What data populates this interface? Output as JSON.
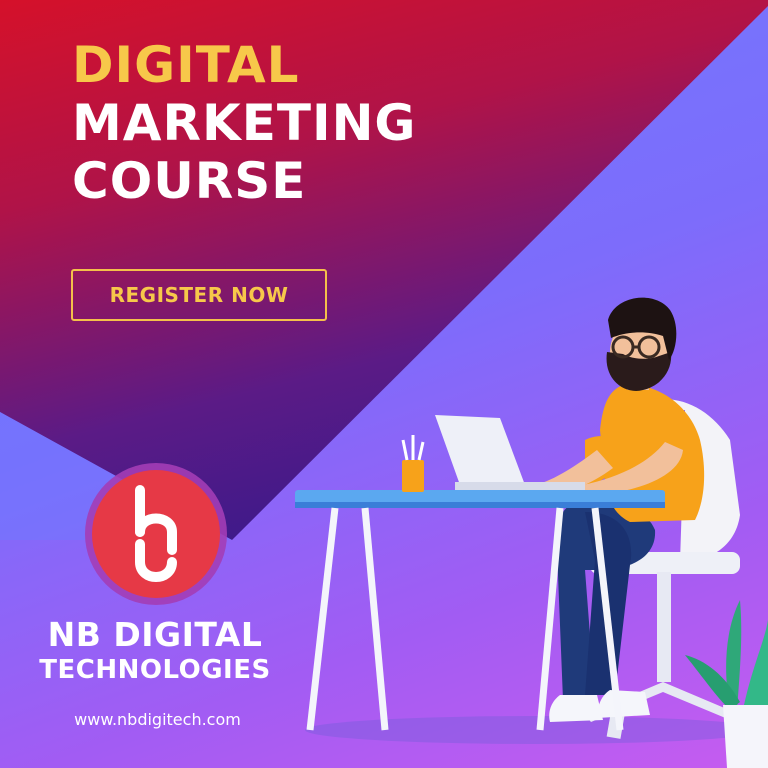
{
  "headline": {
    "line1": "DIGITAL",
    "line2": "MARKETING",
    "line3": "COURSE"
  },
  "cta": {
    "label": "REGISTER NOW"
  },
  "brand": {
    "name_line1": "NB DIGITAL",
    "name_line2": "TECHNOLOGIES",
    "website": "www.nbdigitech.com"
  },
  "colors": {
    "headline_accent": "#f7c84a",
    "red": "#d0112b",
    "purple_dark": "#4a1a8a",
    "logo_red": "#e63946",
    "background_violet": "#8a6cf8"
  },
  "illustration": {
    "subject": "man-working-at-laptop-icon",
    "items": [
      "laptop-icon",
      "pencil-cup-icon",
      "desk-icon",
      "chair-icon",
      "plant-icon"
    ]
  }
}
